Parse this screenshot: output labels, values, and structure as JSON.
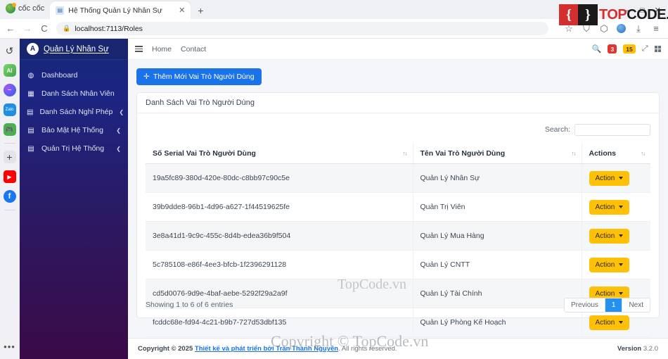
{
  "browser": {
    "brand": "cốc cốc",
    "tab": {
      "title": "Hệ Thống Quản Lý Nhân Sự",
      "close": "✕"
    },
    "new_tab": "+",
    "back": "←",
    "forward": "→",
    "reload": "C",
    "lock_icon": "🔒",
    "url": "localhost:7113/Roles",
    "star_icon": "☆",
    "shield_icon": "⛉",
    "puzzle_icon": "⬡",
    "download_icon": "⤓",
    "menu_icon": "≡",
    "win_minimize": "—",
    "win_maximize": "□",
    "win_close": "✕",
    "rail": [
      {
        "name": "history-icon",
        "label": "↺"
      },
      {
        "name": "ai-icon",
        "label": "AI"
      },
      {
        "name": "messenger-icon",
        "label": "~"
      },
      {
        "name": "zalo-icon",
        "label": "Zalo"
      },
      {
        "name": "game-icon",
        "label": "🎮"
      },
      {
        "name": "add-icon",
        "label": "+"
      },
      {
        "name": "youtube-icon",
        "label": "▶"
      },
      {
        "name": "facebook-icon",
        "label": "f"
      }
    ],
    "rail_more": "•••"
  },
  "sidebar": {
    "brand_badge": "A",
    "brand": "Quản Lý Nhân Sự",
    "items": [
      {
        "label": "Dashboard",
        "icon": "speedometer-icon",
        "glyph": "◍",
        "caret": ""
      },
      {
        "label": "Danh Sách Nhân Viên",
        "icon": "grid-icon",
        "glyph": "▦",
        "caret": ""
      },
      {
        "label": "Danh Sách Nghỉ Phép",
        "icon": "table-icon",
        "glyph": "▤",
        "caret": "❮"
      },
      {
        "label": "Bảo Mật Hệ Thống",
        "icon": "table-icon",
        "glyph": "▤",
        "caret": "❮"
      },
      {
        "label": "Quản Trị Hệ Thống",
        "icon": "table-icon",
        "glyph": "▤",
        "caret": "❮"
      }
    ]
  },
  "topnav": {
    "links": [
      "Home",
      "Contact"
    ],
    "search_icon": "🔍",
    "badge_red": "3",
    "badge_amber": "15",
    "expand_icon": "⤢"
  },
  "page": {
    "add_button": "Thêm Mới Vai Trò Người Dùng",
    "add_icon": "✛",
    "card_title": "Danh Sách Vai Trò Người Dùng",
    "search_label": "Search:",
    "search_value": "",
    "search_placeholder": "",
    "sort_glyph": "↑↓",
    "columns": [
      "Số Serial Vai Trò Người Dùng",
      "Tên Vai Trò Người Dùng",
      "Actions"
    ],
    "rows": [
      {
        "serial": "19a5fc89-380d-420e-80dc-c8bb97c90c5e",
        "name": "Quản Lý Nhân Sự",
        "action": "Action"
      },
      {
        "serial": "39b9dde8-96b1-4d96-a627-1f44519625fe",
        "name": "Quản Trị Viên",
        "action": "Action"
      },
      {
        "serial": "3e8a41d1-9c9c-455c-8d4b-edea36b9f504",
        "name": "Quản Lý Mua Hàng",
        "action": "Action"
      },
      {
        "serial": "5c785108-e86f-4ee3-bfcb-1f2396291128",
        "name": "Quản Lý CNTT",
        "action": "Action"
      },
      {
        "serial": "cd5d0076-9d9e-4baf-aebe-5292f29a2a9f",
        "name": "Quản Lý Tài Chính",
        "action": "Action"
      },
      {
        "serial": "fcddc68e-fd94-4c21-b9b7-727d53dbf135",
        "name": "Quản Lý Phòng Kế Hoạch",
        "action": "Action"
      }
    ],
    "entries": "Showing 1 to 6 of 6 entries",
    "pagination": {
      "previous": "Previous",
      "current": "1",
      "next": "Next"
    }
  },
  "footer": {
    "copyright_prefix": "Copyright © 2025 ",
    "link": "Thiết kế và phát triển bởi Trần Thành Nguyên",
    "copyright_suffix": ". All rights reserved.",
    "version_label": "Version",
    "version": "3.2.0"
  },
  "watermarks": {
    "center": "TopCode.vn",
    "footer": "Copyright © TopCode.vn",
    "logo_left": "{",
    "logo_right": "}",
    "logo_text_a": "TOP",
    "logo_text_b": "CODE.VN"
  },
  "colors": {
    "primary": "#1a73e8",
    "warning": "#ffc107",
    "danger": "#e3342f",
    "sidebar_top": "#16267a",
    "sidebar_bottom": "#3a0a47"
  }
}
